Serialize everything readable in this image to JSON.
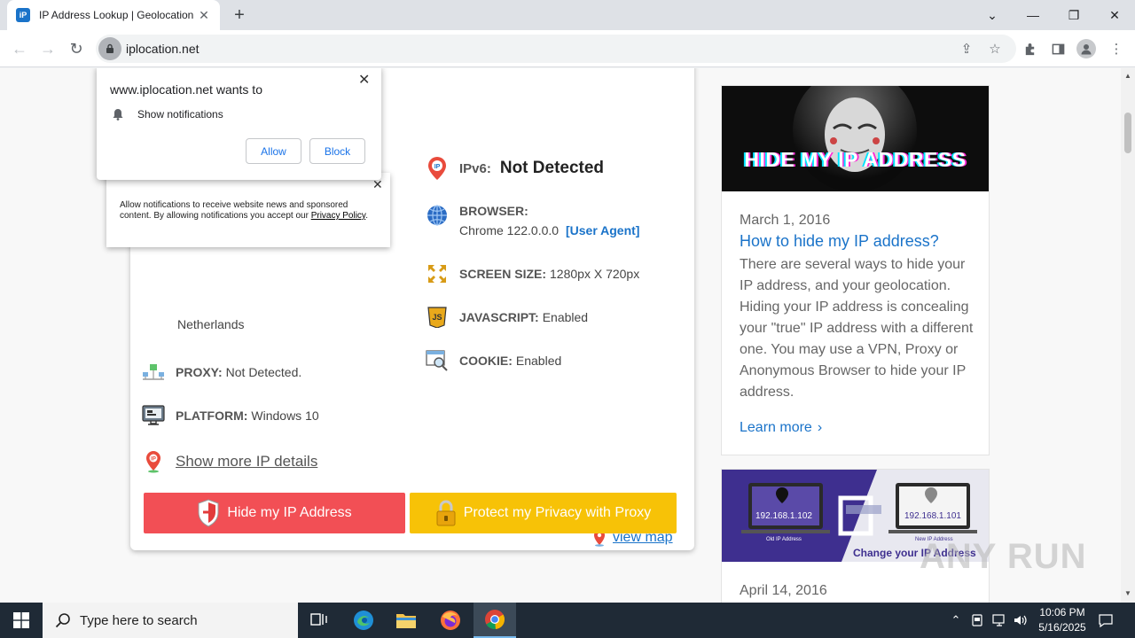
{
  "browser": {
    "tab_title": "IP Address Lookup | Geolocation",
    "tab_favicon_text": "iP",
    "url": "iplocation.net"
  },
  "page": {
    "ipv6_label": "IPv6:",
    "ipv6_value": "Not Detected",
    "browser_label": "BROWSER:",
    "browser_value": "Chrome 122.0.0.0",
    "user_agent_link": "[User Agent]",
    "screen_label": "SCREEN SIZE:",
    "screen_value": "1280px X 720px",
    "javascript_label": "JAVASCRIPT:",
    "javascript_value": "Enabled",
    "cookie_label": "COOKIE:",
    "cookie_value": "Enabled",
    "country_value": "Netherlands",
    "proxy_label": "PROXY:",
    "proxy_value": "Not Detected.",
    "platform_label": "PLATFORM:",
    "platform_value": "Windows 10",
    "show_more_link": "Show more IP details",
    "view_map_link": "view map",
    "hide_ip_button": "Hide my IP Address",
    "protect_button": "Protect my Privacy with Proxy"
  },
  "sidebar": {
    "article1": {
      "banner_text": "HIDE MY IP ADDRESS",
      "date": "March 1, 2016",
      "title": "How to hide my IP address?",
      "body": "There are several ways to hide your IP address, and your geolocation. Hiding your IP address is concealing your \"true\" IP address with a different one. You may use a VPN, Proxy or Anonymous Browser to hide your IP address.",
      "learn_more": "Learn more"
    },
    "article2": {
      "old_ip": "192.168.1.102",
      "old_ip_label": "Old IP Address",
      "new_ip": "192.168.1.101",
      "new_ip_label": "New IP Address",
      "banner_caption": "Change your IP Address",
      "date": "April 14, 2016"
    }
  },
  "notification_prompt": {
    "title": "www.iplocation.net wants to",
    "permission": "Show notifications",
    "allow": "Allow",
    "block": "Block"
  },
  "site_notice": {
    "text": "Allow notifications to receive website news and sponsored content. By allowing notifications you accept our ",
    "link": "Privacy Policy",
    "end": "."
  },
  "taskbar": {
    "search_placeholder": "Type here to search",
    "time": "10:06 PM",
    "date": "5/16/2025"
  },
  "watermark": "ANY RUN",
  "colors": {
    "red_button": "#f24f55",
    "yellow_button": "#f7c207",
    "link_blue": "#1a73c9"
  }
}
